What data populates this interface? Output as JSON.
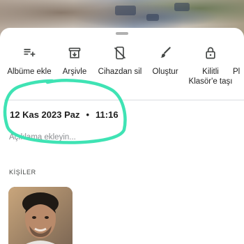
{
  "colors": {
    "annotation_stroke": "#3fe3b4",
    "icon": "#444746",
    "text_primary": "#1f1f1f",
    "text_secondary": "#5f6368",
    "divider": "#dadce0"
  },
  "actions": [
    {
      "id": "add-to-album",
      "icon": "playlist-add-icon",
      "label": "Albüme ekle"
    },
    {
      "id": "archive",
      "icon": "archive-icon",
      "label": "Arşivle"
    },
    {
      "id": "delete-from-device",
      "icon": "phone-off-icon",
      "label": "Cihazdan sil"
    },
    {
      "id": "create",
      "icon": "brush-icon",
      "label": "Oluştur"
    },
    {
      "id": "locked-folder",
      "icon": "lock-icon",
      "label_line1": "Kilitli",
      "label_line2": "Klasör'e taşı"
    },
    {
      "id": "cut-off",
      "label": "Pl"
    }
  ],
  "details": {
    "date": "12 Kas 2023 Paz",
    "separator": "•",
    "time": "11:16",
    "description_placeholder": "Açıklama ekleyin..."
  },
  "people": {
    "title": "KİŞİLER"
  }
}
